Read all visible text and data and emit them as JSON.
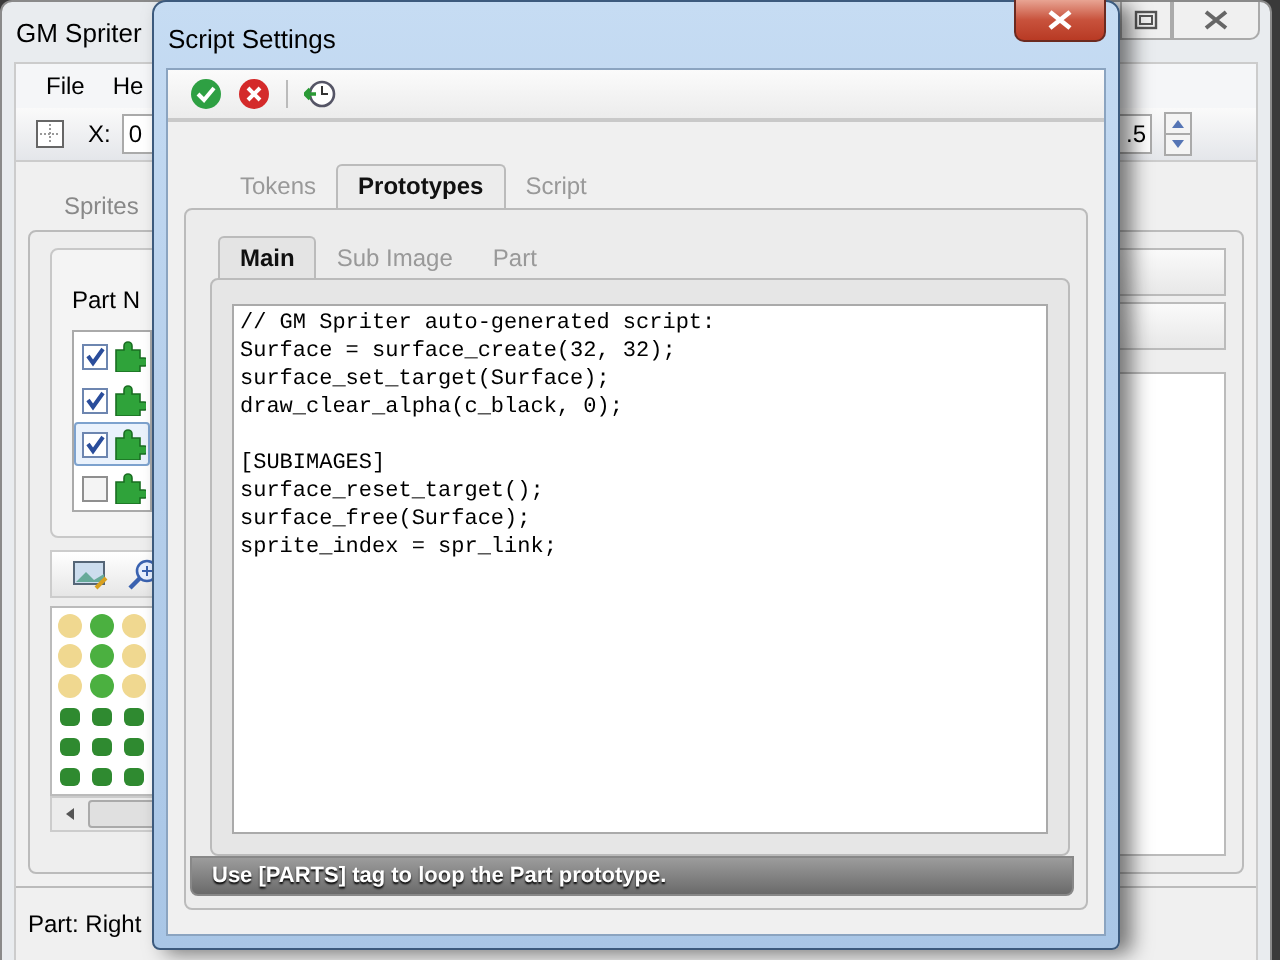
{
  "main_window": {
    "title": "GM Spriter",
    "menu": [
      "File",
      "He"
    ],
    "toolbar": {
      "x_label": "X:",
      "x_value": "0",
      "scale_value": ".5"
    },
    "tabs": [
      {
        "label": "Sprites",
        "selected": false
      }
    ],
    "parts_group": {
      "label": "Part N",
      "rows": [
        {
          "checked": true,
          "selected": false
        },
        {
          "checked": true,
          "selected": false
        },
        {
          "checked": true,
          "selected": true
        },
        {
          "checked": false,
          "selected": false
        }
      ]
    },
    "sprite_preview": {
      "kind": "picture"
    },
    "status_bar": "Part: Right"
  },
  "dialog": {
    "title": "Script Settings",
    "tabs": [
      {
        "label": "Tokens",
        "selected": false
      },
      {
        "label": "Prototypes",
        "selected": true
      },
      {
        "label": "Script",
        "selected": false
      }
    ],
    "subtabs": [
      {
        "label": "Main",
        "selected": true
      },
      {
        "label": "Sub Image",
        "selected": false
      },
      {
        "label": "Part",
        "selected": false
      }
    ],
    "script": "// GM Spriter auto-generated script:\nSurface = surface_create(32, 32);\nsurface_set_target(Surface);\ndraw_clear_alpha(c_black, 0);\n\n[SUBIMAGES]\nsurface_reset_target();\nsurface_free(Surface);\nsprite_index = spr_link;",
    "hint": "Use [PARTS] tag to loop the Part prototype."
  }
}
